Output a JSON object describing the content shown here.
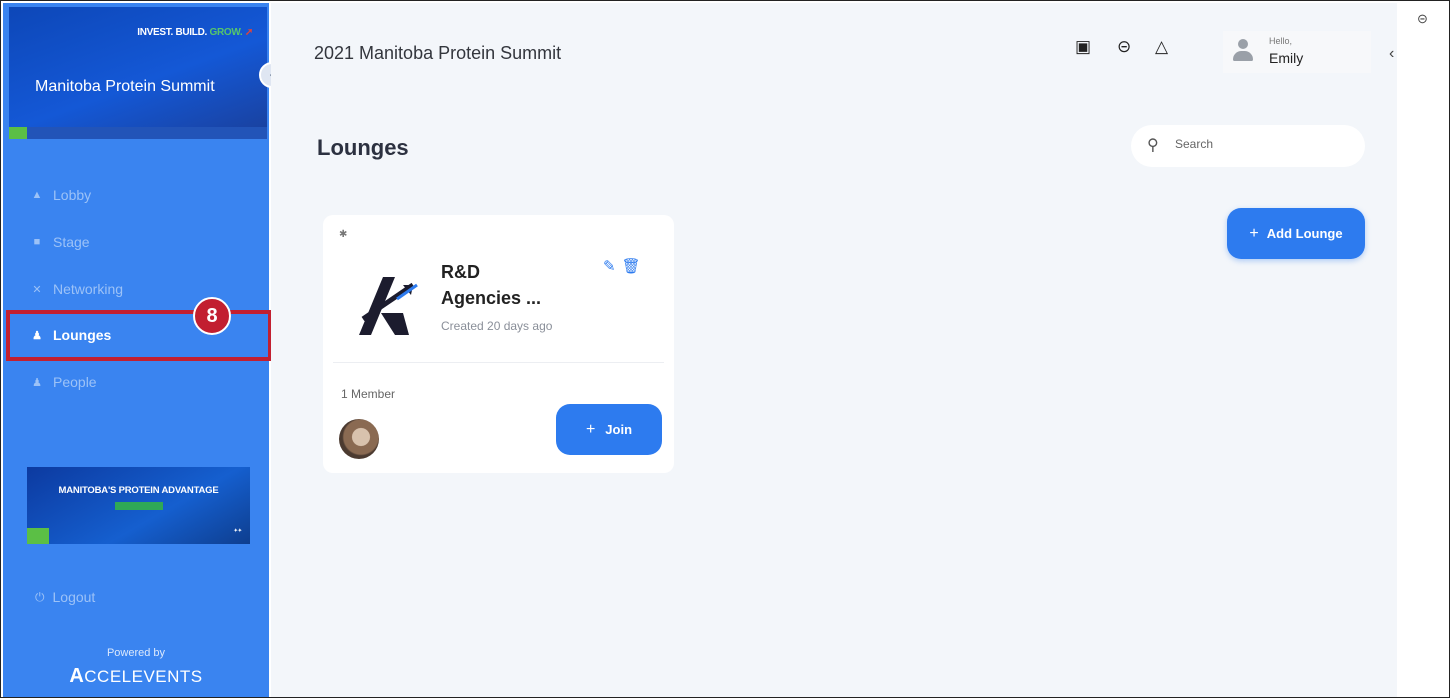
{
  "sidebar": {
    "banner": {
      "tagline_invest": "INVEST. BUILD.",
      "tagline_grow": "GROW.",
      "title": "Manitoba Protein Summit"
    },
    "nav": [
      {
        "label": "Lobby",
        "icon": "home-icon",
        "active": false
      },
      {
        "label": "Stage",
        "icon": "video-icon",
        "active": false
      },
      {
        "label": "Networking",
        "icon": "networking-icon",
        "active": false
      },
      {
        "label": "Lounges",
        "icon": "lounges-icon",
        "active": true
      },
      {
        "label": "People",
        "icon": "person-icon",
        "active": false
      }
    ],
    "callout_badge": "8",
    "ad": {
      "title": "MANITOBA'S PROTEIN ADVANTAGE"
    },
    "logout_label": "Logout",
    "powered_by": "Powered by",
    "brand_first": "A",
    "brand_rest": "CCELEVENTS"
  },
  "header": {
    "title": "2021 Manitoba Protein Summit",
    "greeting": "Hello,",
    "user_name": "Emily"
  },
  "page": {
    "heading": "Lounges",
    "search_placeholder": "Search",
    "add_button_label": "Add Lounge"
  },
  "lounge_card": {
    "title_line1": "R&D",
    "title_line2": "Agencies ...",
    "created": "Created 20 days ago",
    "member_count": "1 Member",
    "join_label": "Join"
  },
  "colors": {
    "sidebar": "#3a84f0",
    "accent": "#2d7bef",
    "highlight": "#c21f30",
    "main_bg": "#f3f6fa"
  }
}
